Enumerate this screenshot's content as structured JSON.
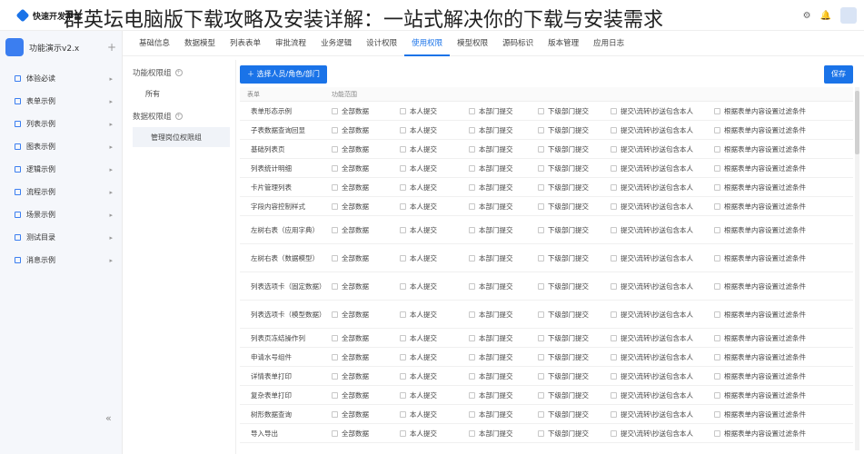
{
  "topbar": {
    "brand": "快速开发平台",
    "overlay_title": "群英坛电脑版下载攻略及安装详解：一站式解决你的下载与安装需求"
  },
  "sidebar": {
    "app_name": "功能演示v2.x",
    "add": "+",
    "collapse": "«",
    "items": [
      {
        "label": "体验必读"
      },
      {
        "label": "表单示例"
      },
      {
        "label": "列表示例"
      },
      {
        "label": "图表示例"
      },
      {
        "label": "逻辑示例"
      },
      {
        "label": "流程示例"
      },
      {
        "label": "场景示例"
      },
      {
        "label": "测试目录"
      },
      {
        "label": "消息示例"
      }
    ]
  },
  "tabs": [
    {
      "label": "基础信息"
    },
    {
      "label": "数据模型"
    },
    {
      "label": "列表表单"
    },
    {
      "label": "审批流程"
    },
    {
      "label": "业务逻辑"
    },
    {
      "label": "设计权限"
    },
    {
      "label": "使用权限"
    },
    {
      "label": "模型权限"
    },
    {
      "label": "源码标识"
    },
    {
      "label": "版本管理"
    },
    {
      "label": "应用日志"
    }
  ],
  "groups": {
    "func_group": "功能权限组",
    "func_items": [
      "所有"
    ],
    "data_group": "数据权限组",
    "data_items": [
      "管理岗位权限组"
    ]
  },
  "buttons": {
    "select": "＋ 选择人员/角色/部门",
    "save": "保存"
  },
  "table": {
    "col_form": "表单",
    "col_scope": "功能范围",
    "options": [
      "全部数据",
      "本人提交",
      "本部门提交",
      "下级部门提交",
      "提交\\流转\\抄送包含本人",
      "根据表单内容设置过滤条件"
    ],
    "rows": [
      "表单形态示例",
      "子表数据查询回显",
      "基础列表页",
      "列表统计明细",
      "卡片管理列表",
      "字段内容控制样式",
      "左树右表（应用字典）",
      "左树右表（数据模型）",
      "列表选项卡（固定数据）",
      "列表选项卡（模型数据）",
      "列表页冻结操作列",
      "申请水号组件",
      "详情表单打印",
      "复杂表单打印",
      "树形数据查询",
      "导入导出"
    ]
  }
}
